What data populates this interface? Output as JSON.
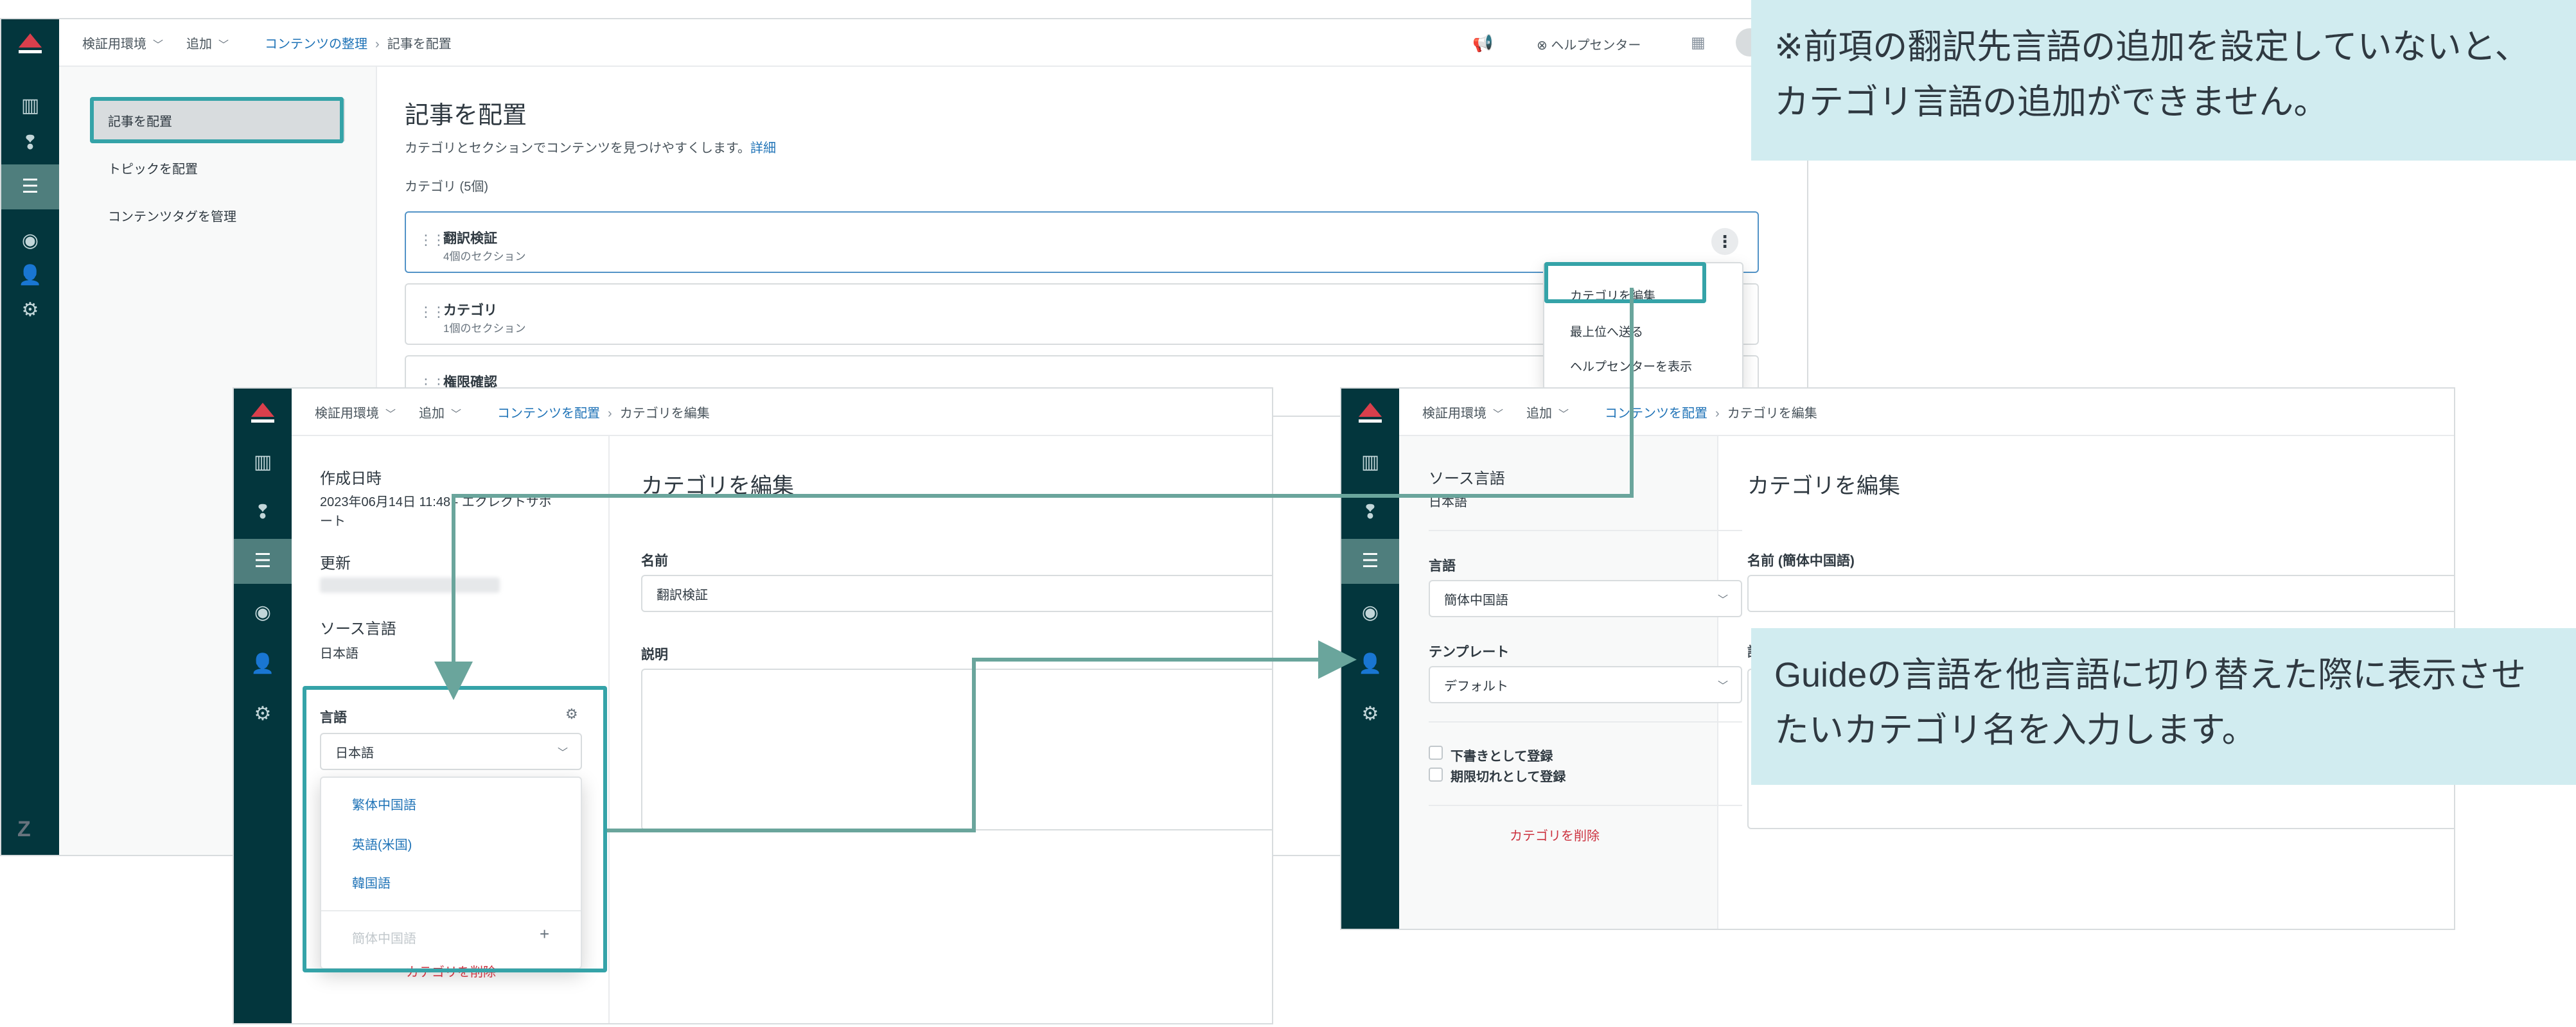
{
  "back_window": {
    "topbar": {
      "env": "検証用環境",
      "add": "追加",
      "crumb_link": "コンテンツの整理",
      "crumb_current": "記事を配置",
      "help_center": "ヘルプセンター"
    },
    "nav": [
      "記事を配置",
      "トピックを配置",
      "コンテンツタグを管理"
    ],
    "title": "記事を配置",
    "description": "カテゴリとセクションでコンテンツを見つけやすくします。",
    "details_link": "詳細",
    "category_count": "カテゴリ (5個)",
    "categories": [
      {
        "title": "翻訳検証",
        "sub": "4個のセクション"
      },
      {
        "title": "カテゴリ",
        "sub": "1個のセクション"
      },
      {
        "title": "権限確認",
        "sub": ""
      }
    ],
    "menu": [
      "カテゴリを編集",
      "最上位へ送る",
      "ヘルプセンターを表示"
    ]
  },
  "left_window": {
    "topbar": {
      "env": "検証用環境",
      "add": "追加",
      "crumb_link": "コンテンツを配置",
      "crumb_current": "カテゴリを編集"
    },
    "created_label": "作成日時",
    "created_value_1": "2023年06月14日 11:48 - エクレクトサポ",
    "created_value_2": "ート",
    "updated_label": "更新",
    "source_lang_label": "ソース言語",
    "source_lang_value": "日本語",
    "lang_label": "言語",
    "lang_value": "日本語",
    "lang_options": [
      "繁体中国語",
      "英語(米国)",
      "韓国語"
    ],
    "lang_disabled": "簡体中国語",
    "delete": "カテゴリを削除",
    "title": "カテゴリを編集",
    "name_label": "名前",
    "name_value": "翻訳検証",
    "desc_label": "説明"
  },
  "right_window": {
    "topbar": {
      "env": "検証用環境",
      "add": "追加",
      "crumb_link": "コンテンツを配置",
      "crumb_current": "カテゴリを編集"
    },
    "source_lang_label": "ソース言語",
    "source_lang_value": "日本語",
    "lang_label": "言語",
    "lang_value": "簡体中国語",
    "template_label": "テンプレート",
    "template_value": "デフォルト",
    "draft": "下書きとして登録",
    "expired": "期限切れとして登録",
    "delete": "カテゴリを削除",
    "title": "カテゴリを編集",
    "name_label": "名前 (簡体中国語)"
  },
  "notes": {
    "top_line1": "※前項の翻訳先言語の追加を設定していないと、",
    "top_line2": "カテゴリ言語の追加ができません。",
    "bottom_line1": "Guideの言語を他言語に切り替えた際に表示させ",
    "bottom_line2": "たいカテゴリ名を入力します。"
  },
  "colors": {
    "rail": "#03363d",
    "highlight": "#35a3a8",
    "arrow": "#6aa59c",
    "note_bg": "#d1ecf0",
    "link": "#1f73b7",
    "danger": "#cc3340"
  }
}
